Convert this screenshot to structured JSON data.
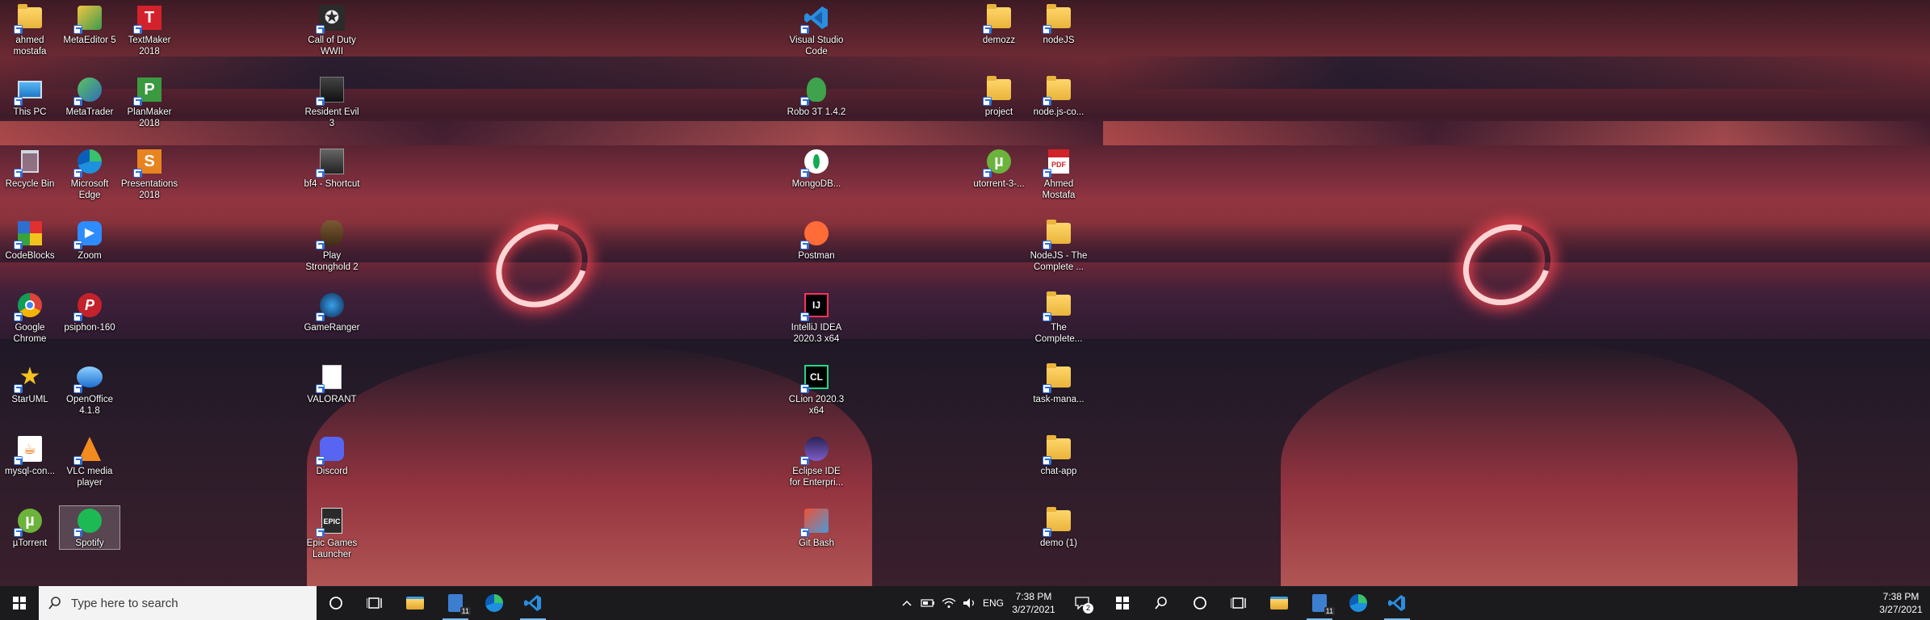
{
  "monitor1": {
    "icons_col1": [
      {
        "name": "ahmed-mostafa-folder-icon",
        "label": "ahmed mostafa",
        "kind": "user-folder"
      },
      {
        "name": "this-pc-icon",
        "label": "This PC",
        "kind": "pc"
      },
      {
        "name": "recycle-bin-icon",
        "label": "Recycle Bin",
        "kind": "bin"
      },
      {
        "name": "codeblocks-icon",
        "label": "CodeBlocks",
        "kind": "codeblocks"
      },
      {
        "name": "google-chrome-icon",
        "label": "Google Chrome",
        "kind": "chrome"
      },
      {
        "name": "staruml-icon",
        "label": "StarUML",
        "kind": "staruml"
      },
      {
        "name": "mysql-connector-icon",
        "label": "mysql-con...",
        "kind": "java"
      },
      {
        "name": "utorrent-icon",
        "label": "µTorrent",
        "kind": "utorrent"
      }
    ],
    "icons_col2": [
      {
        "name": "metaeditor-icon",
        "label": "MetaEditor 5",
        "kind": "metaeditor"
      },
      {
        "name": "metatrader-icon",
        "label": "MetaTrader",
        "kind": "metatrader"
      },
      {
        "name": "microsoft-edge-icon",
        "label": "Microsoft Edge",
        "kind": "edge"
      },
      {
        "name": "zoom-icon",
        "label": "Zoom",
        "kind": "zoom"
      },
      {
        "name": "psiphon-icon",
        "label": "psiphon-160",
        "kind": "psiphon"
      },
      {
        "name": "openoffice-icon",
        "label": "OpenOffice 4.1.8",
        "kind": "openoffice"
      },
      {
        "name": "vlc-icon",
        "label": "VLC media player",
        "kind": "vlc"
      },
      {
        "name": "spotify-icon",
        "label": "Spotify",
        "kind": "spotify"
      }
    ],
    "icons_col3": [
      {
        "name": "textmaker-icon",
        "label": "TextMaker 2018",
        "kind": "textmaker"
      },
      {
        "name": "planmaker-icon",
        "label": "PlanMaker 2018",
        "kind": "planmaker"
      },
      {
        "name": "presentations-icon",
        "label": "Presentations 2018",
        "kind": "presentations"
      }
    ],
    "icons_col4": [
      {
        "name": "call-of-duty-icon",
        "label": "Call of Duty WWII",
        "kind": "cod"
      },
      {
        "name": "resident-evil-icon",
        "label": "Resident Evil 3",
        "kind": "re3"
      },
      {
        "name": "bf4-icon",
        "label": "bf4 - Shortcut",
        "kind": "bf4"
      },
      {
        "name": "stronghold-icon",
        "label": "Play Stronghold 2",
        "kind": "stronghold"
      },
      {
        "name": "gameranger-icon",
        "label": "GameRanger",
        "kind": "gameranger"
      },
      {
        "name": "valorant-icon",
        "label": "VALORANT",
        "kind": "file"
      },
      {
        "name": "discord-icon",
        "label": "Discord",
        "kind": "discord"
      },
      {
        "name": "epic-games-icon",
        "label": "Epic Games Launcher",
        "kind": "epic"
      }
    ],
    "icons_col5": [
      {
        "name": "vscode-icon",
        "label": "Visual Studio Code",
        "kind": "vscode"
      },
      {
        "name": "robo3t-icon",
        "label": "Robo 3T 1.4.2",
        "kind": "robo3t"
      },
      {
        "name": "mongodb-icon",
        "label": "MongoDB...",
        "kind": "mongodb"
      },
      {
        "name": "postman-icon",
        "label": "Postman",
        "kind": "postman"
      },
      {
        "name": "intellij-icon",
        "label": "IntelliJ IDEA 2020.3 x64",
        "kind": "intellij"
      },
      {
        "name": "clion-icon",
        "label": "CLion 2020.3 x64",
        "kind": "clion"
      },
      {
        "name": "eclipse-icon",
        "label": "Eclipse IDE for Enterpri...",
        "kind": "eclipse"
      },
      {
        "name": "git-bash-icon",
        "label": "Git Bash",
        "kind": "gitbash"
      }
    ],
    "icons_col6": [
      {
        "name": "demozz-folder-icon",
        "label": "demozz",
        "kind": "folder"
      },
      {
        "name": "project-folder-icon",
        "label": "project",
        "kind": "folder"
      },
      {
        "name": "utorrent-3-icon",
        "label": "utorrent-3-...",
        "kind": "utorrent"
      }
    ],
    "icons_col7": [
      {
        "name": "nodejs-folder-icon",
        "label": "nodeJS",
        "kind": "folder"
      },
      {
        "name": "nodejs-co-folder-icon",
        "label": "node.js-co...",
        "kind": "folder"
      },
      {
        "name": "ahmed-mostafa-pdf-icon",
        "label": "Ahmed Mostafa",
        "kind": "pdf"
      },
      {
        "name": "nodejs-complete-folder-icon",
        "label": "NodeJS - The Complete ...",
        "kind": "folder"
      },
      {
        "name": "the-complete-folder-icon",
        "label": "The Complete...",
        "kind": "folder"
      },
      {
        "name": "task-manager-folder-icon",
        "label": "task-mana...",
        "kind": "folder"
      },
      {
        "name": "chat-app-folder-icon",
        "label": "chat-app",
        "kind": "folder"
      },
      {
        "name": "demo-1-folder-icon",
        "label": "demo (1)",
        "kind": "folder"
      }
    ],
    "taskbar": {
      "search_placeholder": "Type here to search",
      "lang": "ENG",
      "time": "7:38 PM",
      "date": "3/27/2021",
      "notification_count": "2",
      "badge_taskmanager": "11"
    }
  },
  "monitor2": {
    "taskbar": {
      "time": "7:38 PM",
      "date": "3/27/2021",
      "badge_taskmanager": "11"
    }
  },
  "colors": {
    "taskbar": "#1b1b1e",
    "accent": "#76b9ed",
    "search_bg": "#f3f3f3"
  }
}
